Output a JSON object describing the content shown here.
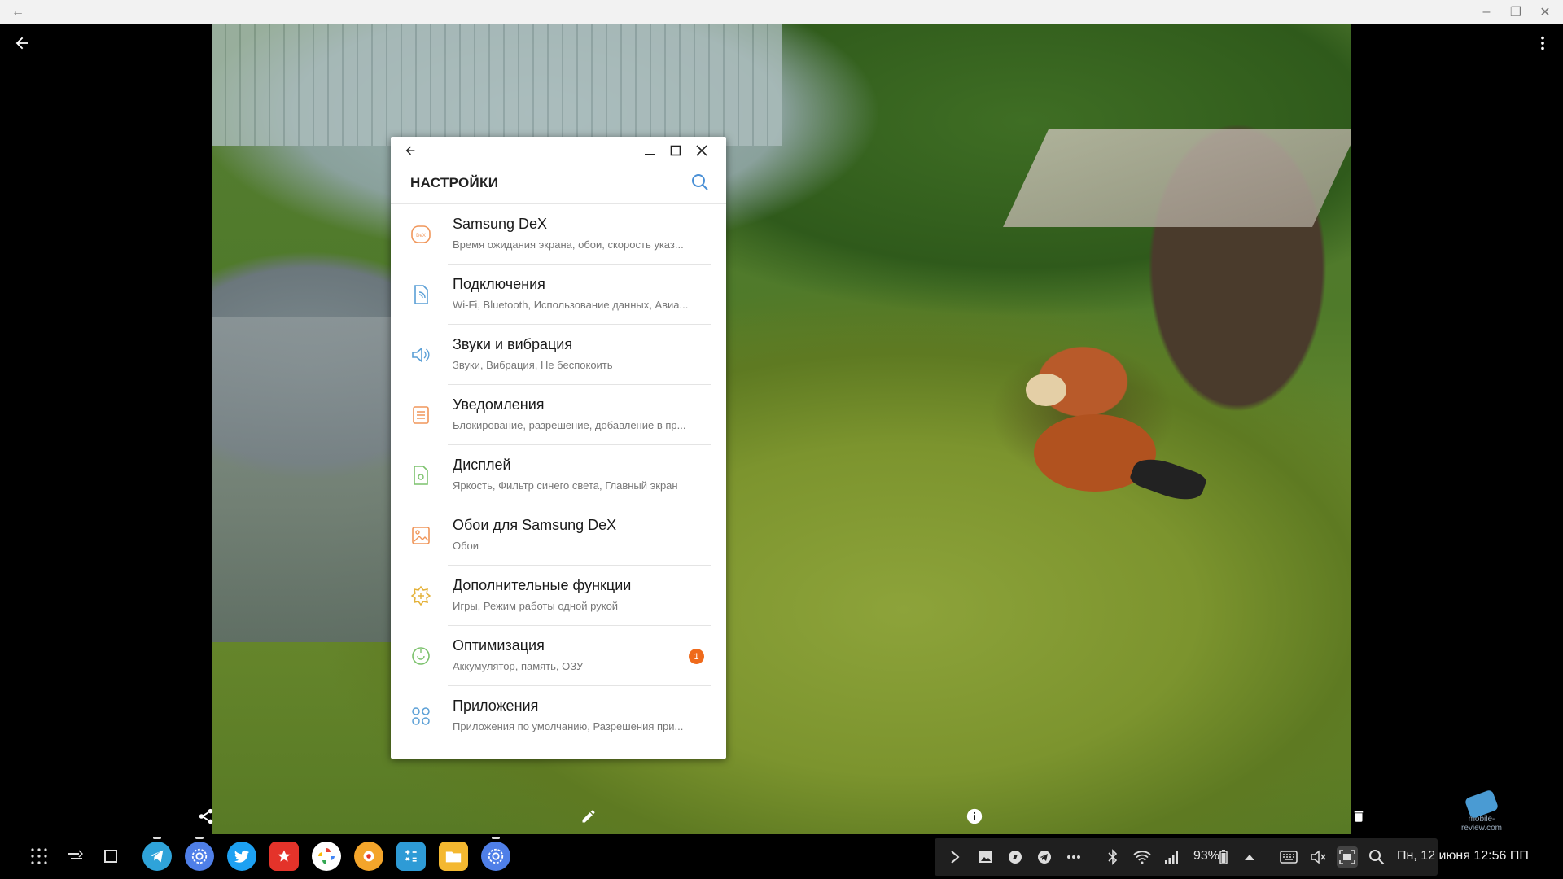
{
  "settings": {
    "title": "НАСТРОЙКИ",
    "items": [
      {
        "title": "Samsung DeX",
        "subtitle": "Время ожидания экрана, обои, скорость указ...",
        "icon": "dex-icon"
      },
      {
        "title": "Подключения",
        "subtitle": "Wi-Fi, Bluetooth, Использование данных, Авиа...",
        "icon": "connections-icon"
      },
      {
        "title": "Звуки и вибрация",
        "subtitle": "Звуки, Вибрация, Не беспокоить",
        "icon": "sound-icon"
      },
      {
        "title": "Уведомления",
        "subtitle": "Блокирование, разрешение, добавление в пр...",
        "icon": "notifications-icon"
      },
      {
        "title": "Дисплей",
        "subtitle": "Яркость, Фильтр синего света, Главный экран",
        "icon": "display-icon"
      },
      {
        "title": "Обои для Samsung DeX",
        "subtitle": "Обои",
        "icon": "wallpaper-icon"
      },
      {
        "title": "Дополнительные функции",
        "subtitle": "Игры, Режим работы одной рукой",
        "icon": "advanced-features-icon"
      },
      {
        "title": "Оптимизация",
        "subtitle": "Аккумулятор, память, ОЗУ",
        "icon": "optimization-icon",
        "badge": "1"
      },
      {
        "title": "Приложения",
        "subtitle": "Приложения по умолчанию, Разрешения при...",
        "icon": "apps-icon"
      }
    ]
  },
  "tray": {
    "battery": "93%",
    "datetime": "Пн, 12 июня  12:56 ПП"
  },
  "watermark": "mobile-review.com",
  "colors": {
    "accent": "#ef6a1b",
    "icon_orange": "#f0965a",
    "icon_blue": "#5a9fd6",
    "icon_green": "#7cc26d",
    "icon_yellow": "#e4b23a"
  }
}
